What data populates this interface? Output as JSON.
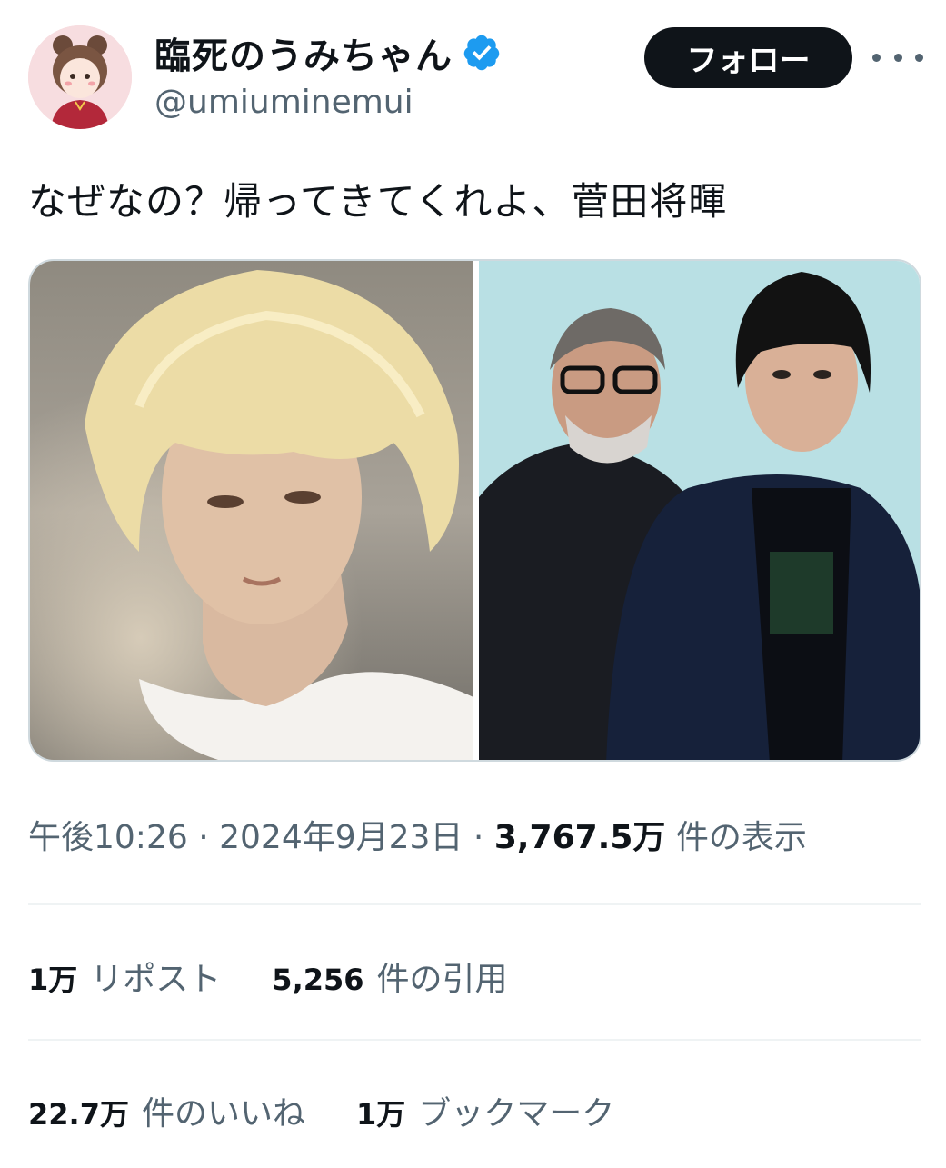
{
  "author": {
    "display_name": "臨死のうみちゃん",
    "handle": "@umiuminemui",
    "verified_icon": "verified-badge-icon",
    "avatar": "avatar-illustration"
  },
  "header": {
    "follow_label": "フォロー",
    "more_icon": "more-icon"
  },
  "tweet": {
    "text": "なぜなの？帰ってきてくれよ、菅田将暉"
  },
  "media": {
    "images": [
      "photo-blonde-young-man",
      "photo-two-men-portrait"
    ]
  },
  "meta": {
    "time": "午後10:26",
    "date": "2024年9月23日",
    "views_value": "3,767.5万",
    "views_label": "件の表示",
    "separator": "·"
  },
  "stats": {
    "reposts_value": "1万",
    "reposts_label": "リポスト",
    "quotes_value": "5,256",
    "quotes_label": "件の引用",
    "likes_value": "22.7万",
    "likes_label": "件のいいね",
    "bookmarks_value": "1万",
    "bookmarks_label": "ブックマーク"
  },
  "colors": {
    "text_primary": "#0f1419",
    "text_secondary": "#536471",
    "verified_blue": "#1d9bf0",
    "divider": "#eff3f4"
  }
}
